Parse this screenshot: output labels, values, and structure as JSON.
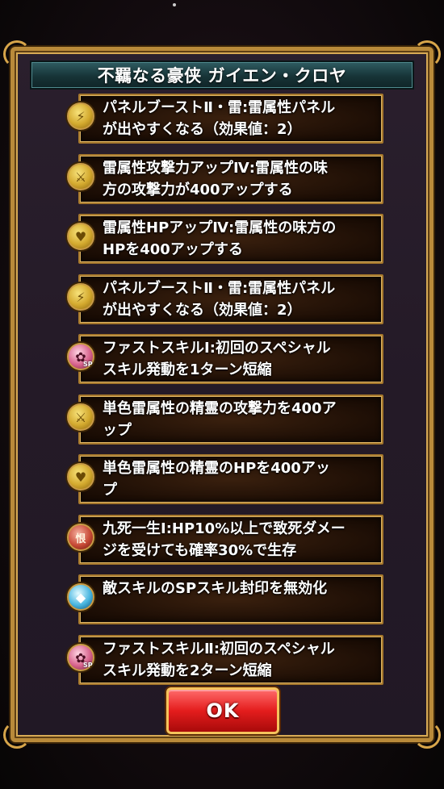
{
  "dialog": {
    "title": "不羈なる豪侠 ガイエン・クロヤ",
    "ok_label": "OK"
  },
  "skills": [
    {
      "text": "パネルブーストⅡ・雷:雷属性パネル\nが出やすくなる（効果値：2）",
      "icon": "thunder-orb-icon"
    },
    {
      "text": "雷属性攻撃力アップⅣ:雷属性の味\n方の攻撃力が400アップする",
      "icon": "sword-attack-up-icon"
    },
    {
      "text": "雷属性HPアップⅣ:雷属性の味方の\nHPを400アップする",
      "icon": "heart-hp-up-icon"
    },
    {
      "text": "パネルブーストⅡ・雷:雷属性パネル\nが出やすくなる（効果値：2）",
      "icon": "thunder-orb-icon"
    },
    {
      "text": "ファストスキルⅠ:初回のスペシャル\nスキル発動を1ターン短縮",
      "icon": "fast-skill-sp-icon"
    },
    {
      "text": "単色雷属性の精霊の攻撃力を400ア\nップ",
      "icon": "sword-attack-up-icon"
    },
    {
      "text": "単色雷属性の精霊のHPを400アッ\nプ",
      "icon": "heart-hp-up-icon"
    },
    {
      "text": "九死一生Ⅰ:HP10%以上で致死ダメー\nジを受けても確率30%で生存",
      "icon": "survival-icon"
    },
    {
      "text": "敵スキルのSPスキル封印を無効化",
      "icon": "sp-seal-guard-icon"
    },
    {
      "text": "ファストスキルⅡ:初回のスペシャル\nスキル発動を2ターン短縮",
      "icon": "fast-skill-sp-icon"
    }
  ],
  "icon_glyphs": {
    "thunder-orb-icon": "⚡",
    "sword-attack-up-icon": "⚔",
    "heart-hp-up-icon": "♥",
    "fast-skill-sp-icon": "✿",
    "survival-icon": "恨",
    "sp-seal-guard-icon": "◆"
  },
  "sp_tag": "SP",
  "colors": {
    "frame_gold": "#b98a3a",
    "title_teal": "#173437",
    "ok_red": "#e41d1d"
  }
}
